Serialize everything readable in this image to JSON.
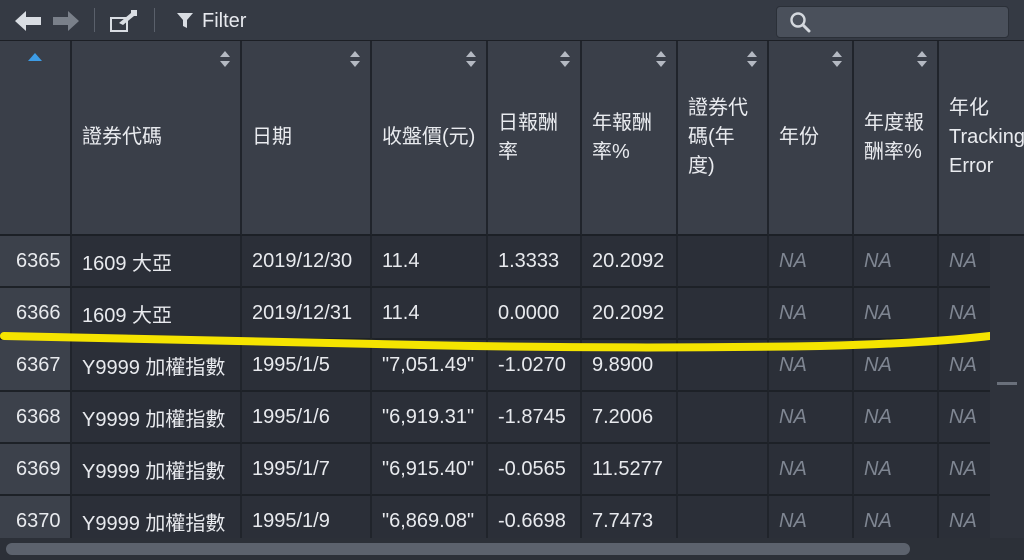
{
  "toolbar": {
    "back_icon": "left-arrow-icon",
    "forward_icon": "right-arrow-icon",
    "export_icon": "export-icon",
    "filter_label": "Filter",
    "search_placeholder": ""
  },
  "columns": [
    {
      "label": "",
      "sort": "ascending"
    },
    {
      "label": "證券代碼"
    },
    {
      "label": "日期"
    },
    {
      "label": "收盤價(元)"
    },
    {
      "label": "日報酬率"
    },
    {
      "label": "年報酬率%"
    },
    {
      "label": "證券代碼(年度)"
    },
    {
      "label": "年份"
    },
    {
      "label": "年度報酬率%"
    },
    {
      "label": "年化Tracking Error"
    }
  ],
  "rows": [
    {
      "idx": "6365",
      "code": "1609 大亞",
      "date": "2019/12/30",
      "close": "11.4",
      "daily": "1.3333",
      "annual": "20.2092",
      "code_year": "",
      "year": "NA",
      "annual_ret": "NA",
      "te": "NA"
    },
    {
      "idx": "6366",
      "code": "1609 大亞",
      "date": "2019/12/31",
      "close": "11.4",
      "daily": "0.0000",
      "annual": "20.2092",
      "code_year": "",
      "year": "NA",
      "annual_ret": "NA",
      "te": "NA"
    },
    {
      "idx": "6367",
      "code": "Y9999 加權指數",
      "date": "1995/1/5",
      "close": "\"7,051.49\"",
      "daily": "-1.0270",
      "annual": "9.8900",
      "code_year": "",
      "year": "NA",
      "annual_ret": "NA",
      "te": "NA"
    },
    {
      "idx": "6368",
      "code": "Y9999 加權指數",
      "date": "1995/1/6",
      "close": "\"6,919.31\"",
      "daily": "-1.8745",
      "annual": "7.2006",
      "code_year": "",
      "year": "NA",
      "annual_ret": "NA",
      "te": "NA"
    },
    {
      "idx": "6369",
      "code": "Y9999 加權指數",
      "date": "1995/1/7",
      "close": "\"6,915.40\"",
      "daily": "-0.0565",
      "annual": "11.5277",
      "code_year": "",
      "year": "NA",
      "annual_ret": "NA",
      "te": "NA"
    },
    {
      "idx": "6370",
      "code": "Y9999 加權指數",
      "date": "1995/1/9",
      "close": "\"6,869.08\"",
      "daily": "-0.6698",
      "annual": "7.7473",
      "code_year": "",
      "year": "NA",
      "annual_ret": "NA",
      "te": "NA"
    }
  ],
  "colors": {
    "highlight": "#f5e400",
    "sort_active": "#3d9ce6"
  }
}
